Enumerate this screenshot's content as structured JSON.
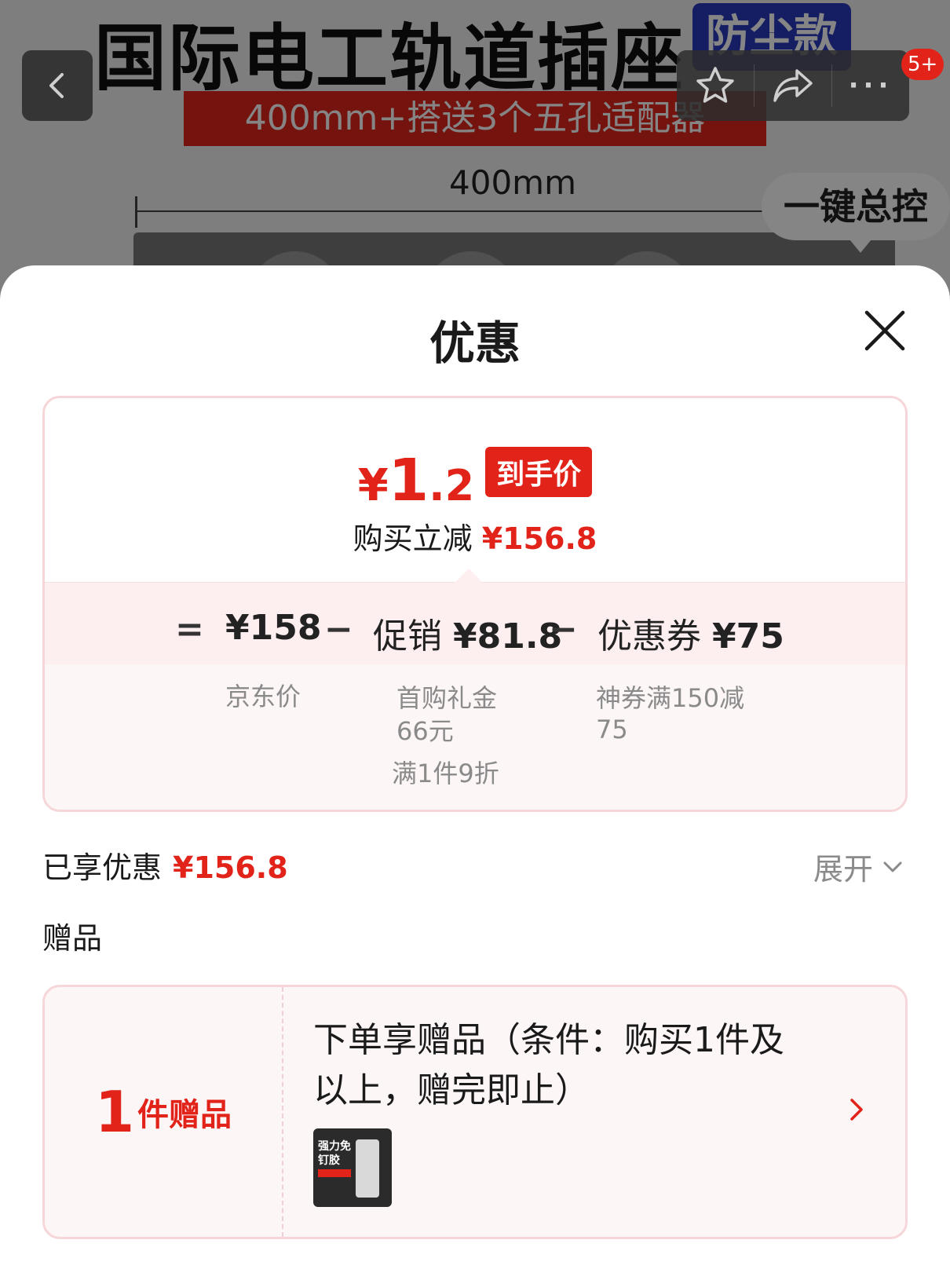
{
  "hero": {
    "title": "国际电工轨道插座",
    "badge": "防尘款",
    "banner": "400mm+搭送3个五孔适配器",
    "dimension": "400mm",
    "bubble": "一键总控"
  },
  "nav": {
    "back_icon": "chevron-left-icon",
    "favorite_icon": "star-icon",
    "share_icon": "share-icon",
    "more_icon": "more-icon",
    "more_glyph": "···",
    "message_badge": "5+"
  },
  "sheet": {
    "title": "优惠",
    "close_icon": "close-icon"
  },
  "price": {
    "currency": "¥",
    "final_int": "1",
    "final_dec": ".2",
    "final_tag": "到手价",
    "saving_label": "购买立减",
    "saving_value": "¥156.8"
  },
  "formula": {
    "equals": "=",
    "minus": "−",
    "base_value": "¥158",
    "base_label": "京东价",
    "promo_label": "促销",
    "promo_value": "¥81.8",
    "promo_details": [
      "首购礼金",
      "66元",
      "满1件9折"
    ],
    "coupon_label": "优惠券",
    "coupon_value": "¥75",
    "coupon_details": [
      "神券满150减",
      "75"
    ]
  },
  "enjoyed": {
    "label": "已享优惠",
    "value": "¥156.8",
    "expand_label": "展开"
  },
  "gifts": {
    "heading": "赠品",
    "count": "1",
    "count_label": "件赠品",
    "line1": "下单享赠品（条件：购买1件及",
    "line2": "以上，赠完即止）",
    "thumb_text": "强力免钉胶"
  },
  "colors": {
    "accent": "#e2231a",
    "card_border": "#f7d6d9",
    "band_bg": "#fdeef0"
  }
}
